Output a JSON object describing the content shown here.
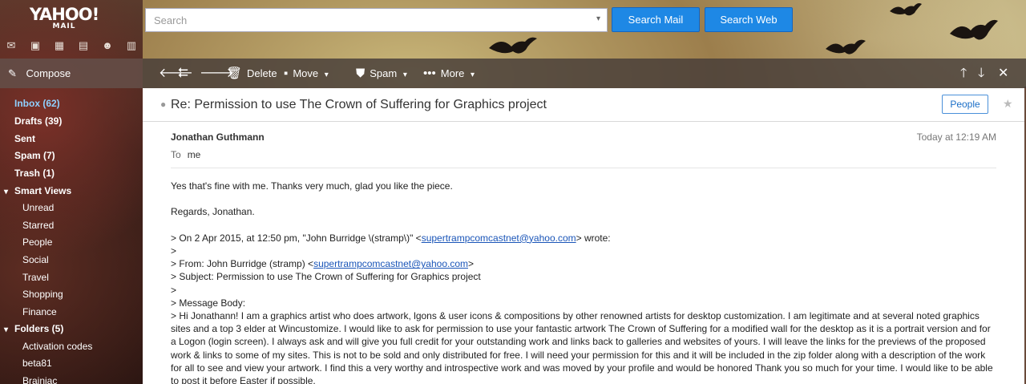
{
  "brand": {
    "logo": "YAHOO!",
    "logo_sub": "MAIL"
  },
  "app_icons": [
    "mail-icon",
    "contacts-icon",
    "calendar-icon",
    "notepad-icon",
    "messenger-icon",
    "newsfeed-icon"
  ],
  "search": {
    "placeholder": "Search",
    "search_mail": "Search Mail",
    "search_web": "Search Web"
  },
  "toolbar": {
    "compose": "Compose",
    "delete": "Delete",
    "move": "Move",
    "spam": "Spam",
    "more": "More"
  },
  "sidebar": {
    "folders": [
      {
        "label": "Inbox (62)",
        "active": true
      },
      {
        "label": "Drafts (39)"
      },
      {
        "label": "Sent"
      },
      {
        "label": "Spam (7)"
      },
      {
        "label": "Trash (1)"
      }
    ],
    "smart_views": {
      "label": "Smart Views",
      "items": [
        "Unread",
        "Starred",
        "People",
        "Social",
        "Travel",
        "Shopping",
        "Finance"
      ]
    },
    "user_folders": {
      "label": "Folders (5)",
      "items": [
        "Activation codes",
        "beta81",
        "Brainiac"
      ]
    }
  },
  "message": {
    "subject": "Re: Permission to use The Crown of Suffering for Graphics project",
    "people_button": "People",
    "sender": "Jonathan Guthmann",
    "time": "Today at 12:19 AM",
    "to_label": "To",
    "to_value": "me",
    "body": {
      "line1": "Yes that's fine with me. Thanks very much, glad you like the piece.",
      "line2": "Regards, Jonathan.",
      "q1_pre": "> On 2 Apr 2015, at 12:50 pm, \"John Burridge \\(stramp\\)\" <",
      "q1_link": "supertrampcomcastnet@yahoo.com",
      "q1_post": "> wrote:",
      "q2": ">",
      "q3_pre": "> From: John Burridge (stramp) <",
      "q3_link": "supertrampcomcastnet@yahoo.com",
      "q3_post": ">",
      "q4": "> Subject: Permission to use The Crown of Suffering  for Graphics project",
      "q5": ">",
      "q6": "> Message Body:",
      "q7": "> Hi Jonathann! I am a graphics artist who does artwork, lgons & user icons & compositions by other renowned artists for desktop customization. I am legitimate and at several noted graphics sites and a top 3 elder at Wincustomize. I would like to ask for permission to use your fantastic artwork The Crown of Suffering for a modified wall for the desktop as it is a portrait version and for a Logon (login screen). I always ask and will give you full credit for your outstanding work and links back to galleries and websites of yours. I will leave the links for the previews of the proposed work & links to some of my sites. This is not to be sold and only distributed for free. I will need your permission for this and it will be included in the zip folder along with a description of the work for all to see and view your artwork. I find this a very worthy and introspective work and was moved by your profile and would be honored  Thank you so much for your time. I would like to be able to post it before Easter if possible."
    }
  }
}
